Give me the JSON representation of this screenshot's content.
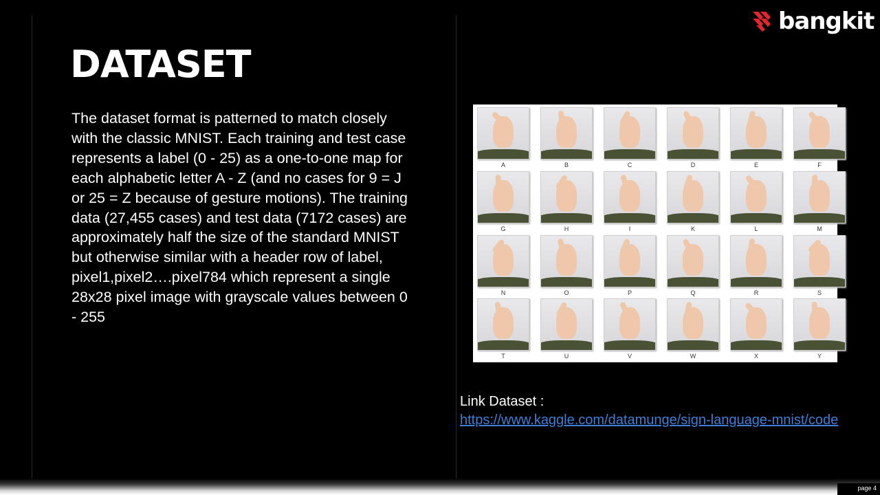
{
  "slide": {
    "title": "DATASET",
    "body": "The dataset format is patterned to match closely with the classic MNIST. Each training and test case represents a label (0 - 25) as a one-to-one map for each alphabetic letter A - Z (and no cases for 9 = J or 25 = Z because of gesture motions). The training data (27,455 cases) and test data (7172 cases) are approximately half the size of the standard MNIST but otherwise similar with a header row of label, pixel1,pixel2….pixel784 which represent a single 28x28 pixel image with grayscale values between 0 - 255",
    "link_label": "Link Dataset :",
    "link_url": "https://www.kaggle.com/datamunge/sign-language-mnist/code",
    "page_number": "page 4"
  },
  "logo": {
    "text": "bangkit",
    "icon": "bangkit-logo-icon",
    "accent_color": "#e3262c"
  },
  "asl_letters": [
    "A",
    "B",
    "C",
    "D",
    "E",
    "F",
    "G",
    "H",
    "I",
    "K",
    "L",
    "M",
    "N",
    "O",
    "P",
    "Q",
    "R",
    "S",
    "T",
    "U",
    "V",
    "W",
    "X",
    "Y"
  ],
  "colors": {
    "background": "#000000",
    "text": "#ffffff",
    "link": "#3d7fd6"
  }
}
